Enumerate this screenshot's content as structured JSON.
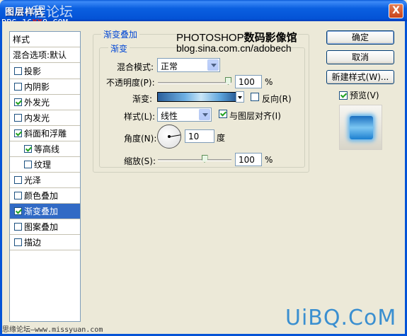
{
  "window": {
    "title": "图层样式",
    "watermark_top": "程论坛",
    "watermark_url_prefix": "BBS.16",
    "watermark_url_red": "XX",
    "watermark_url_suffix": "8.COM",
    "close_label": "X"
  },
  "sidebar": {
    "header_styles": "样式",
    "header_blend": "混合选项:默认",
    "items": [
      {
        "label": "投影",
        "checked": false
      },
      {
        "label": "内阴影",
        "checked": false
      },
      {
        "label": "外发光",
        "checked": true
      },
      {
        "label": "内发光",
        "checked": false
      },
      {
        "label": "斜面和浮雕",
        "checked": true
      },
      {
        "label": "等高线",
        "checked": true
      },
      {
        "label": "纹理",
        "checked": false
      },
      {
        "label": "光泽",
        "checked": false
      },
      {
        "label": "颜色叠加",
        "checked": false
      },
      {
        "label": "渐变叠加",
        "checked": true
      },
      {
        "label": "图案叠加",
        "checked": false
      },
      {
        "label": "描边",
        "checked": false
      }
    ]
  },
  "panel": {
    "group_title": "渐变叠加",
    "inner_title": "渐变",
    "overlay_line1": "PHOTOSHOP",
    "overlay_line1_bold": "数码影像馆",
    "overlay_line2": "blog.sina.com.cn/adobech",
    "blend_mode_label": "混合模式:",
    "blend_mode_value": "正常",
    "opacity_label": "不透明度(P):",
    "opacity_value": "100",
    "opacity_level": 1.0,
    "percent": "%",
    "gradient_label": "渐变:",
    "reverse_label": "反向(R)",
    "style_label": "样式(L):",
    "style_value": "线性",
    "align_label": "与图层对齐(I)",
    "angle_label": "角度(N):",
    "angle_value": "10",
    "degree_unit": "度",
    "scale_label": "缩放(S):",
    "scale_value": "100",
    "scale_level": 0.5
  },
  "buttons": {
    "ok": "确定",
    "cancel": "取消",
    "new_style": "新建样式(W)...",
    "preview": "预览(V)"
  },
  "footer": {
    "watermark_right": "UiBQ.CoM",
    "watermark_left": "思缘论坛—www.missyuan.com"
  },
  "colors": {
    "titlebar": "#0453d6",
    "selection": "#316ac5",
    "legend_text": "#0046d5"
  }
}
